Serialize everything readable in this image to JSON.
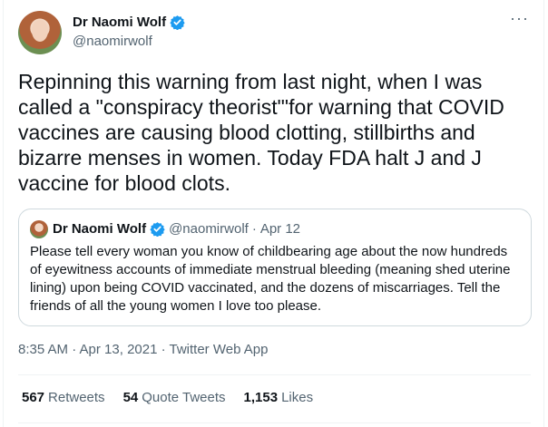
{
  "author": {
    "name": "Dr Naomi Wolf",
    "handle": "@naomirwolf"
  },
  "more_icon": "more-horizontal-icon",
  "tweet_text": "Repinning this warning from last night, when I was called a \"conspiracy theorist\"'for warning that COVID vaccines are causing blood clotting, stillbirths and bizarre menses in women. Today FDA halt J and J vaccine for blood clots.",
  "quoted": {
    "name": "Dr Naomi Wolf",
    "handle": "@naomirwolf",
    "separator": "·",
    "date": "Apr 12",
    "text": "Please tell every woman you know of childbearing age about the now hundreds of eyewitness accounts of immediate menstrual bleeding (meaning shed uterine lining) upon being COVID vaccinated, and the dozens of miscarriages. Tell the friends of all the young women I love too please."
  },
  "timestamp": "8:35 AM · Apr 13, 2021 · Twitter Web App",
  "stats": {
    "retweets_count": "567",
    "retweets_label": "Retweets",
    "quotes_count": "54",
    "quotes_label": "Quote Tweets",
    "likes_count": "1,153",
    "likes_label": "Likes"
  },
  "colors": {
    "verified": "#1d9bf0",
    "secondary_text": "#536471",
    "border": "#cfd9de"
  }
}
